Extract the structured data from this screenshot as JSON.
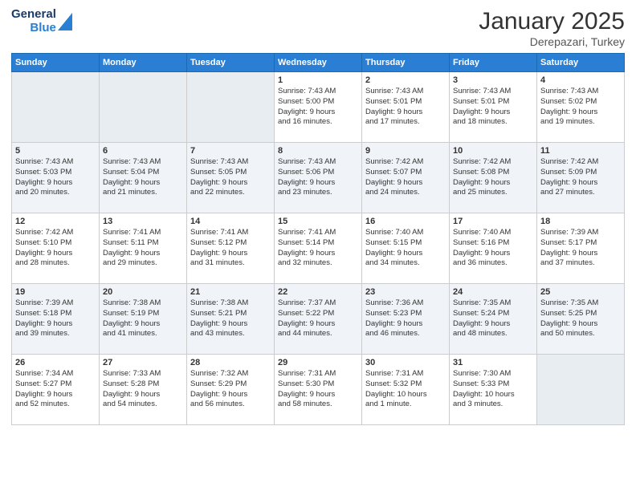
{
  "header": {
    "logo_general": "General",
    "logo_blue": "Blue",
    "month_year": "January 2025",
    "location": "Derepazari, Turkey"
  },
  "days_of_week": [
    "Sunday",
    "Monday",
    "Tuesday",
    "Wednesday",
    "Thursday",
    "Friday",
    "Saturday"
  ],
  "weeks": [
    [
      {
        "day": "",
        "content": ""
      },
      {
        "day": "",
        "content": ""
      },
      {
        "day": "",
        "content": ""
      },
      {
        "day": "1",
        "content": "Sunrise: 7:43 AM\nSunset: 5:00 PM\nDaylight: 9 hours\nand 16 minutes."
      },
      {
        "day": "2",
        "content": "Sunrise: 7:43 AM\nSunset: 5:01 PM\nDaylight: 9 hours\nand 17 minutes."
      },
      {
        "day": "3",
        "content": "Sunrise: 7:43 AM\nSunset: 5:01 PM\nDaylight: 9 hours\nand 18 minutes."
      },
      {
        "day": "4",
        "content": "Sunrise: 7:43 AM\nSunset: 5:02 PM\nDaylight: 9 hours\nand 19 minutes."
      }
    ],
    [
      {
        "day": "5",
        "content": "Sunrise: 7:43 AM\nSunset: 5:03 PM\nDaylight: 9 hours\nand 20 minutes."
      },
      {
        "day": "6",
        "content": "Sunrise: 7:43 AM\nSunset: 5:04 PM\nDaylight: 9 hours\nand 21 minutes."
      },
      {
        "day": "7",
        "content": "Sunrise: 7:43 AM\nSunset: 5:05 PM\nDaylight: 9 hours\nand 22 minutes."
      },
      {
        "day": "8",
        "content": "Sunrise: 7:43 AM\nSunset: 5:06 PM\nDaylight: 9 hours\nand 23 minutes."
      },
      {
        "day": "9",
        "content": "Sunrise: 7:42 AM\nSunset: 5:07 PM\nDaylight: 9 hours\nand 24 minutes."
      },
      {
        "day": "10",
        "content": "Sunrise: 7:42 AM\nSunset: 5:08 PM\nDaylight: 9 hours\nand 25 minutes."
      },
      {
        "day": "11",
        "content": "Sunrise: 7:42 AM\nSunset: 5:09 PM\nDaylight: 9 hours\nand 27 minutes."
      }
    ],
    [
      {
        "day": "12",
        "content": "Sunrise: 7:42 AM\nSunset: 5:10 PM\nDaylight: 9 hours\nand 28 minutes."
      },
      {
        "day": "13",
        "content": "Sunrise: 7:41 AM\nSunset: 5:11 PM\nDaylight: 9 hours\nand 29 minutes."
      },
      {
        "day": "14",
        "content": "Sunrise: 7:41 AM\nSunset: 5:12 PM\nDaylight: 9 hours\nand 31 minutes."
      },
      {
        "day": "15",
        "content": "Sunrise: 7:41 AM\nSunset: 5:14 PM\nDaylight: 9 hours\nand 32 minutes."
      },
      {
        "day": "16",
        "content": "Sunrise: 7:40 AM\nSunset: 5:15 PM\nDaylight: 9 hours\nand 34 minutes."
      },
      {
        "day": "17",
        "content": "Sunrise: 7:40 AM\nSunset: 5:16 PM\nDaylight: 9 hours\nand 36 minutes."
      },
      {
        "day": "18",
        "content": "Sunrise: 7:39 AM\nSunset: 5:17 PM\nDaylight: 9 hours\nand 37 minutes."
      }
    ],
    [
      {
        "day": "19",
        "content": "Sunrise: 7:39 AM\nSunset: 5:18 PM\nDaylight: 9 hours\nand 39 minutes."
      },
      {
        "day": "20",
        "content": "Sunrise: 7:38 AM\nSunset: 5:19 PM\nDaylight: 9 hours\nand 41 minutes."
      },
      {
        "day": "21",
        "content": "Sunrise: 7:38 AM\nSunset: 5:21 PM\nDaylight: 9 hours\nand 43 minutes."
      },
      {
        "day": "22",
        "content": "Sunrise: 7:37 AM\nSunset: 5:22 PM\nDaylight: 9 hours\nand 44 minutes."
      },
      {
        "day": "23",
        "content": "Sunrise: 7:36 AM\nSunset: 5:23 PM\nDaylight: 9 hours\nand 46 minutes."
      },
      {
        "day": "24",
        "content": "Sunrise: 7:35 AM\nSunset: 5:24 PM\nDaylight: 9 hours\nand 48 minutes."
      },
      {
        "day": "25",
        "content": "Sunrise: 7:35 AM\nSunset: 5:25 PM\nDaylight: 9 hours\nand 50 minutes."
      }
    ],
    [
      {
        "day": "26",
        "content": "Sunrise: 7:34 AM\nSunset: 5:27 PM\nDaylight: 9 hours\nand 52 minutes."
      },
      {
        "day": "27",
        "content": "Sunrise: 7:33 AM\nSunset: 5:28 PM\nDaylight: 9 hours\nand 54 minutes."
      },
      {
        "day": "28",
        "content": "Sunrise: 7:32 AM\nSunset: 5:29 PM\nDaylight: 9 hours\nand 56 minutes."
      },
      {
        "day": "29",
        "content": "Sunrise: 7:31 AM\nSunset: 5:30 PM\nDaylight: 9 hours\nand 58 minutes."
      },
      {
        "day": "30",
        "content": "Sunrise: 7:31 AM\nSunset: 5:32 PM\nDaylight: 10 hours\nand 1 minute."
      },
      {
        "day": "31",
        "content": "Sunrise: 7:30 AM\nSunset: 5:33 PM\nDaylight: 10 hours\nand 3 minutes."
      },
      {
        "day": "",
        "content": ""
      }
    ]
  ]
}
